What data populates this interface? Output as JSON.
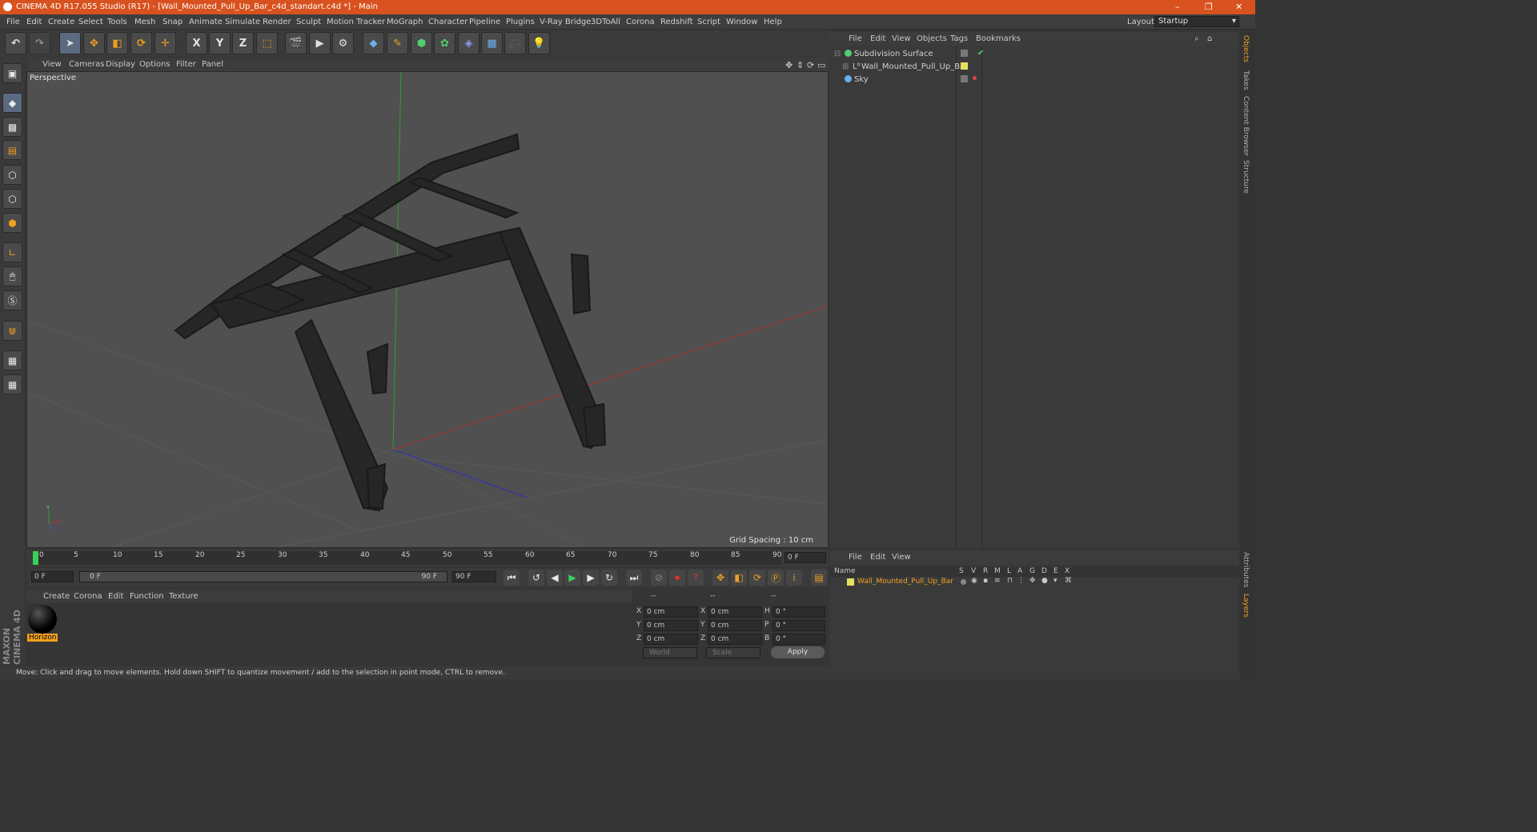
{
  "window": {
    "title": "CINEMA 4D R17.055 Studio (R17) - [Wall_Mounted_Pull_Up_Bar_c4d_standart.c4d *] - Main",
    "controls": [
      "–",
      "❐",
      "✕"
    ]
  },
  "menubar": {
    "items": [
      "File",
      "Edit",
      "Create",
      "Select",
      "Tools",
      "Mesh",
      "Snap",
      "Animate",
      "Simulate",
      "Render",
      "Sculpt",
      "Motion Tracker",
      "MoGraph",
      "Character",
      "Pipeline",
      "Plugins",
      "V-Ray Bridge",
      "3DToAll",
      "Corona",
      "Redshift",
      "Script",
      "Window",
      "Help"
    ],
    "layout_label": "Layout:",
    "layout_value": "Startup"
  },
  "toolbar": {
    "axis_x": "X",
    "axis_y": "Y",
    "axis_z": "Z"
  },
  "viewport": {
    "menu": [
      "View",
      "Cameras",
      "Display",
      "Options",
      "Filter",
      "Panel"
    ],
    "label": "Perspective",
    "grid_spacing": "Grid Spacing : 10 cm"
  },
  "timeline": {
    "ticks": [
      "0",
      "5",
      "10",
      "15",
      "20",
      "25",
      "30",
      "35",
      "40",
      "45",
      "50",
      "55",
      "60",
      "65",
      "70",
      "75",
      "80",
      "85",
      "90"
    ],
    "current_frame": "0 F",
    "start_field": "0 F",
    "range_start": "0 F",
    "range_end": "90 F",
    "end_field": "90 F"
  },
  "material_manager": {
    "menu": [
      "Create",
      "Corona",
      "Edit",
      "Function",
      "Texture"
    ],
    "material_name": "Horizon"
  },
  "coordinates": {
    "header": [
      "--",
      "--",
      "--"
    ],
    "rows": [
      {
        "a": "X",
        "av": "0 cm",
        "b": "X",
        "bv": "0 cm",
        "c": "H",
        "cv": "0 °"
      },
      {
        "a": "Y",
        "av": "0 cm",
        "b": "Y",
        "bv": "0 cm",
        "c": "P",
        "cv": "0 °"
      },
      {
        "a": "Z",
        "av": "0 cm",
        "b": "Z",
        "bv": "0 cm",
        "c": "B",
        "cv": "0 °"
      }
    ],
    "world": "World",
    "scale": "Scale",
    "apply": "Apply"
  },
  "status": {
    "text": "Move: Click and drag to move elements. Hold down SHIFT to quantize movement / add to the selection in point mode, CTRL to remove."
  },
  "object_manager": {
    "menu": [
      "File",
      "Edit",
      "View",
      "Objects",
      "Tags",
      "Bookmarks"
    ],
    "objects": [
      "Subdivision Surface",
      "Wall_Mounted_Pull_Up_Bar",
      "Sky"
    ]
  },
  "layer_manager": {
    "menu": [
      "File",
      "Edit",
      "View"
    ],
    "columns": [
      "Name",
      "S",
      "V",
      "R",
      "M",
      "L",
      "A",
      "G",
      "D",
      "E",
      "X"
    ],
    "layer_name": "Wall_Mounted_Pull_Up_Bar"
  },
  "side_tabs": [
    "Objects",
    "Takes",
    "Content Browser",
    "Structure"
  ],
  "side_tabs_bottom": [
    "Attributes",
    "Layers"
  ],
  "brand": "MAXON CINEMA 4D",
  "colors": {
    "title_bar": "#d8521f",
    "accent_orange": "#f0a020",
    "layer_color": "#e8e060"
  }
}
